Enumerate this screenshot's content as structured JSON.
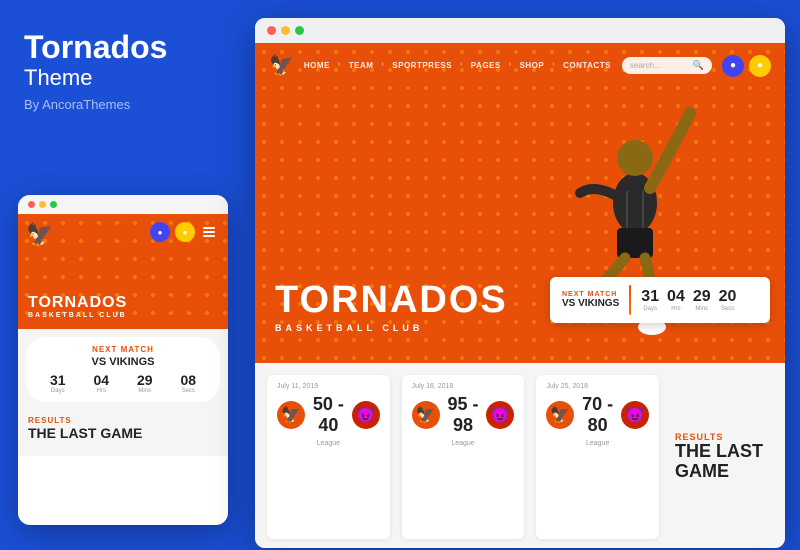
{
  "brand": {
    "title": "Tornados",
    "subtitle": "Theme",
    "by": "By AncoraThemes"
  },
  "titlebar": {
    "dots": [
      "#ff5f57",
      "#febc2e",
      "#28c840"
    ]
  },
  "nav": {
    "links": [
      "HOME",
      "TEAM",
      "SPORTPRESS",
      "PAGES",
      "SHOP",
      "CONTACTS"
    ],
    "search_placeholder": "search...",
    "logo_emoji": "🦅"
  },
  "hero": {
    "title": "TORNADOS",
    "subtitle": "BASKETBALL CLUB",
    "bg_color": "#e8500a"
  },
  "next_match": {
    "label": "NEXT MATCH",
    "vs": "VS VIKINGS",
    "countdown": [
      {
        "num": "31",
        "label": "Days"
      },
      {
        "num": "04",
        "label": "Hrs"
      },
      {
        "num": "29",
        "label": "Mins"
      },
      {
        "num": "20",
        "label": "Secs"
      }
    ]
  },
  "mobile_next_match": {
    "label": "NEXT MATCH",
    "vs": "VS VIKINGS",
    "countdown": [
      {
        "num": "31",
        "label": "Days"
      },
      {
        "num": "04",
        "label": "Hrs"
      },
      {
        "num": "29",
        "label": "Mins"
      },
      {
        "num": "08",
        "label": "Secs"
      }
    ]
  },
  "results": [
    {
      "date": "July 11, 2019",
      "score": "50 - 40",
      "type": "League",
      "team1_color": "#e8500a",
      "team2_color": "#cc2200"
    },
    {
      "date": "July 18, 2018",
      "score": "95 - 98",
      "type": "League",
      "team1_color": "#e8500a",
      "team2_color": "#cc2200"
    },
    {
      "date": "July 25, 2018",
      "score": "70 - 80",
      "type": "League",
      "team1_color": "#e8500a",
      "team2_color": "#cc2200"
    }
  ],
  "last_game": {
    "label": "RESULTS",
    "title": "THE LAST GAME"
  },
  "mobile": {
    "team_name": "TORNADOS",
    "team_sub": "BASKETBALL CLUB",
    "results_label": "RESULTS",
    "results_title": "THE LAST GAME"
  }
}
